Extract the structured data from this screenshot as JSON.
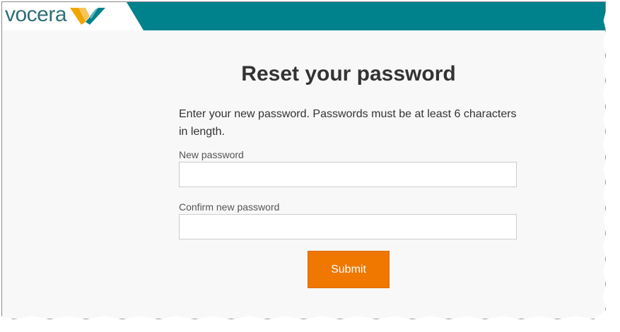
{
  "brand": {
    "logo_text": "vocera",
    "logo_mark_icon": "vocera-v-logo-icon",
    "header_color": "#00828d",
    "logo_color": "#2f6f78",
    "mark_colors": [
      "#f0a500",
      "#00828d"
    ]
  },
  "form": {
    "title": "Reset your password",
    "instructions": "Enter your new password. Passwords must be at least 6 characters in length.",
    "new_password_label": "New password",
    "new_password_value": "",
    "confirm_password_label": "Confirm new password",
    "confirm_password_value": "",
    "submit_label": "Submit",
    "submit_color": "#f07800"
  }
}
